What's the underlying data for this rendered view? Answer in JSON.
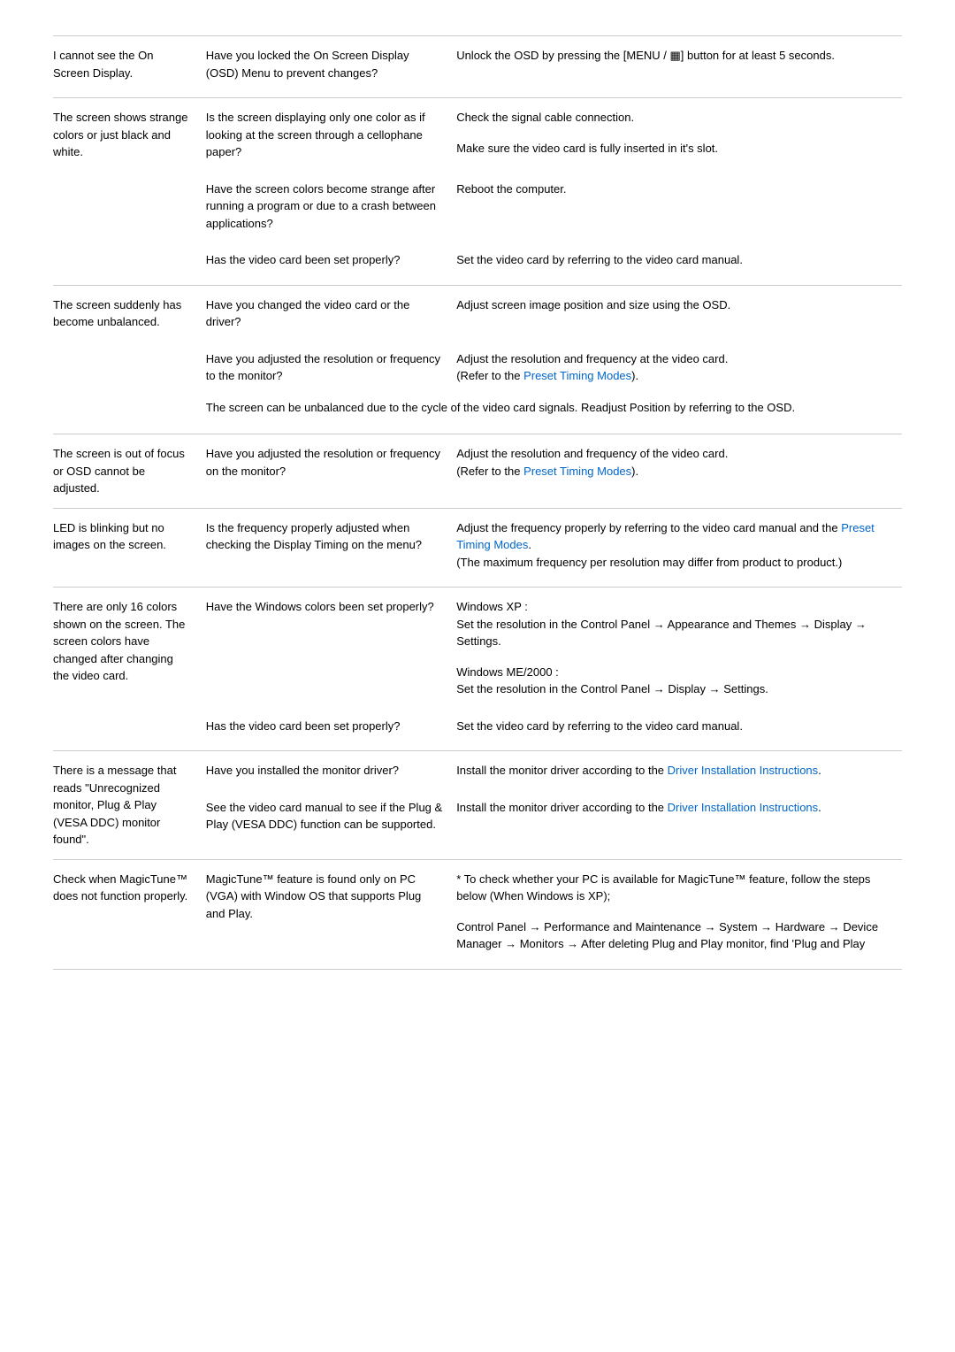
{
  "rows": [
    {
      "id": "row-osd",
      "problem": "I cannot see the On Screen Display.",
      "checks": [
        {
          "check": "Have you locked the On Screen Display (OSD) Menu to prevent changes?",
          "solution": "Unlock the OSD by pressing the [MENU / ▦] button for at least 5 seconds.",
          "solutionLinks": []
        }
      ],
      "fullWidthNote": null
    },
    {
      "id": "row-strange-colors",
      "problem": "The screen shows strange colors or just black and white.",
      "checks": [
        {
          "check": "Is the screen displaying only one color as if looking at the screen through a cellophane paper?",
          "solution": "Check the signal cable connection.\n\nMake sure the video card is fully inserted in it's slot.",
          "solutionLinks": []
        },
        {
          "check": "Have the screen colors become strange after running a program or due to a crash between applications?",
          "solution": "Reboot the computer.",
          "solutionLinks": []
        },
        {
          "check": "Has the video card been set properly?",
          "solution": "Set the video card by referring to the video card manual.",
          "solutionLinks": []
        }
      ],
      "fullWidthNote": null
    },
    {
      "id": "row-unbalanced",
      "problem": "The screen suddenly has become unbalanced.",
      "checks": [
        {
          "check": "Have you changed the video card or the driver?",
          "solution": "Adjust screen image position and size using the OSD.",
          "solutionLinks": []
        },
        {
          "check": "Have you adjusted the resolution or frequency to the monitor?",
          "solution": "Adjust the resolution and frequency at the video card.\n(Refer to the Preset Timing Modes).",
          "solutionLinks": [
            {
              "text": "Preset Timing Modes",
              "url": "#"
            }
          ]
        }
      ],
      "fullWidthNote": "The screen can be unbalanced due to the cycle of the video card signals. Readjust Position by referring to the OSD."
    },
    {
      "id": "row-focus",
      "problem": "The screen is out of focus or OSD cannot be adjusted.",
      "checks": [
        {
          "check": "Have you adjusted the resolution or frequency on the monitor?",
          "solution": "Adjust the resolution and frequency of the video card.\n(Refer to the Preset Timing Modes).",
          "solutionLinks": [
            {
              "text": "Preset Timing Modes",
              "url": "#"
            }
          ]
        }
      ],
      "fullWidthNote": null
    },
    {
      "id": "row-led-blinking",
      "problem": "LED is blinking but no images on the screen.",
      "checks": [
        {
          "check": "Is the frequency properly adjusted when checking the Display Timing on the menu?",
          "solution": "Adjust the frequency properly by referring to the video card manual and the Preset Timing Modes.\n(The maximum frequency per resolution may differ from product to product.)",
          "solutionLinks": [
            {
              "text": "Preset Timing Modes",
              "url": "#"
            }
          ]
        }
      ],
      "fullWidthNote": null
    },
    {
      "id": "row-16colors",
      "problem": "There are only 16 colors shown on the screen. The screen colors have changed after changing the video card.",
      "checks": [
        {
          "check": "Have the Windows colors been set properly?",
          "solution": "Windows XP :\nSet the resolution in the Control Panel → Appearance and Themes → Display → Settings.\n\nWindows ME/2000 :\nSet the resolution in the Control Panel → Display → Settings.",
          "solutionLinks": []
        },
        {
          "check": "Has the video card been set properly?",
          "solution": "Set the video card by referring to the video card manual.",
          "solutionLinks": []
        }
      ],
      "fullWidthNote": null
    },
    {
      "id": "row-unrecognized",
      "problem": "There is a message that reads \"Unrecognized monitor, Plug & Play (VESA DDC) monitor found\".",
      "checks": [
        {
          "check": "Have you installed the monitor driver?",
          "solution": "Install the monitor driver according to the Driver Installation Instructions.",
          "solutionLinks": [
            {
              "text": "Driver Installation Instructions",
              "url": "#"
            }
          ]
        },
        {
          "check": "See the video card manual to see if the Plug & Play (VESA DDC) function can be supported.",
          "solution": "Install the monitor driver according to the Driver Installation Instructions.",
          "solutionLinks": [
            {
              "text": "Driver Installation Instructions",
              "url": "#"
            }
          ]
        }
      ],
      "fullWidthNote": null
    },
    {
      "id": "row-magictune",
      "problem": "Check when MagicTune™ does not function properly.",
      "checks": [
        {
          "check": "MagicTune™ feature is found only on PC (VGA) with Window OS that supports Plug and Play.",
          "solution": "* To check whether your PC is available for MagicTune™ feature, follow the steps below (When Windows is XP);\n\nControl Panel → Performance and Maintenance → System → Hardware → Device Manager → Monitors → After deleting Plug and Play monitor, find 'Plug and Play",
          "solutionLinks": []
        }
      ],
      "fullWidthNote": null
    }
  ]
}
